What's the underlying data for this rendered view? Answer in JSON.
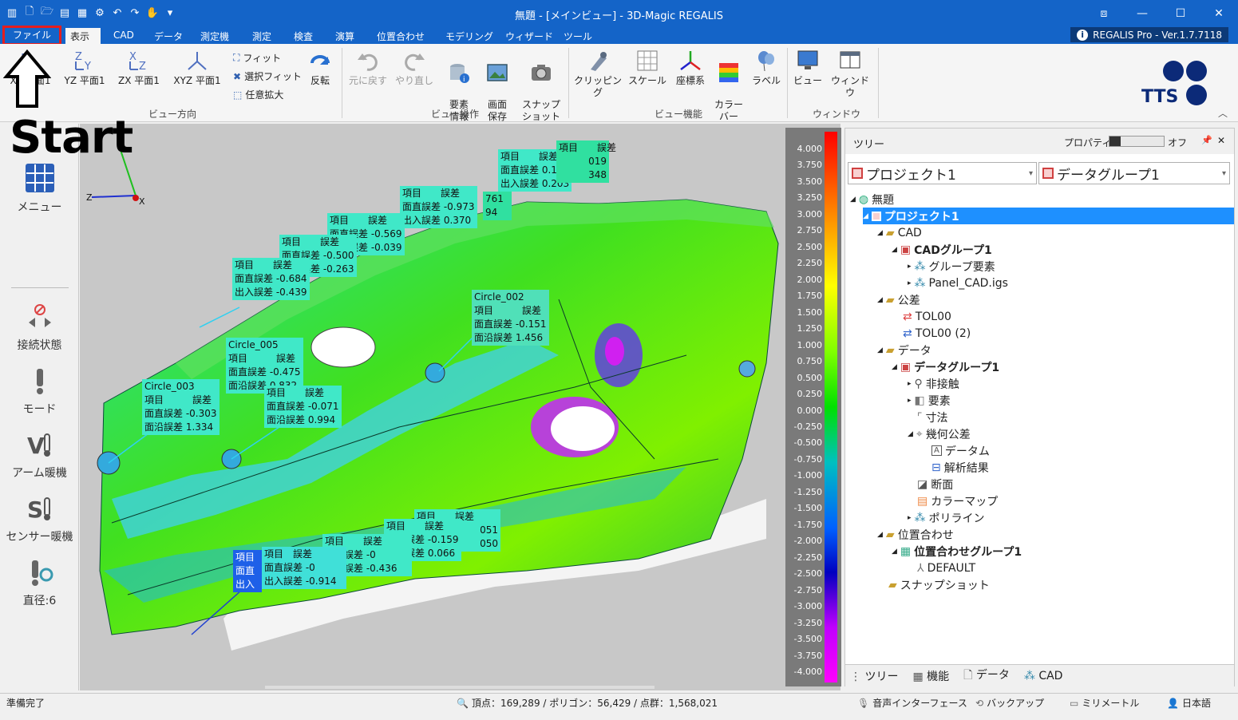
{
  "window": {
    "title": "無題 - [メインビュー] - 3D-Magic REGALIS"
  },
  "tabs": [
    {
      "label": "ファイル"
    },
    {
      "label": "表示"
    },
    {
      "label": "CAD"
    },
    {
      "label": "データ"
    },
    {
      "label": "測定機"
    },
    {
      "label": "測定"
    },
    {
      "label": "検査"
    },
    {
      "label": "演算"
    },
    {
      "label": "位置合わせ"
    },
    {
      "label": "モデリング"
    },
    {
      "label": "ウィザード"
    },
    {
      "label": "ツール"
    }
  ],
  "version": "REGALIS Pro - Ver.1.7.7118",
  "ribbon": {
    "view_direction": {
      "group_label": "ビュー方向",
      "xy": "XY 平面1",
      "yz": "YZ 平面1",
      "zx": "ZX 平面1",
      "xyz": "XYZ 平面1",
      "fit": "フィット",
      "select_fit": "選択フィット",
      "zoom_any": "任意拡大",
      "flip": "反転"
    },
    "view_ops": {
      "group_label": "ビュー操作",
      "undo": "元に戻す",
      "redo": "やり直し",
      "elem_info": "要素\n情報",
      "save_screen": "画面\n保存",
      "snapshot": "スナップ\nショット"
    },
    "view_func": {
      "group_label": "ビュー機能",
      "clipping": "クリッピング",
      "scale": "スケール",
      "coord": "座標系",
      "colorbar": "カラー\nバー",
      "label": "ラベル"
    },
    "window": {
      "group_label": "ウィンドウ",
      "view": "ビュー",
      "window": "ウィンドウ"
    },
    "logo_text": "TTS"
  },
  "overlay": {
    "start": "Start"
  },
  "left_panel": {
    "menu": "メニュー",
    "connection": "接続状態",
    "mode": "モード",
    "arm_warmup": "アーム暖機",
    "sensor_warmup": "センサー暖機",
    "diameter": "直径:6"
  },
  "colorbar": {
    "ticks": [
      "4.000",
      "3.750",
      "3.500",
      "3.250",
      "3.000",
      "2.750",
      "2.500",
      "2.250",
      "2.000",
      "1.750",
      "1.500",
      "1.250",
      "1.000",
      "0.750",
      "0.500",
      "0.250",
      "0.000",
      "-0.250",
      "-0.500",
      "-0.750",
      "-1.000",
      "-1.250",
      "-1.500",
      "-1.750",
      "-2.000",
      "-2.250",
      "-2.500",
      "-2.750",
      "-3.000",
      "-3.250",
      "-3.500",
      "-3.750",
      "-4.000"
    ]
  },
  "labels": [
    {
      "lines": [
        "項目　　誤差",
        "面直誤差 0.171",
        "出入誤差 0.203"
      ]
    },
    {
      "lines": [
        "項目　　誤差",
        "019",
        "348"
      ]
    },
    {
      "lines": [
        "項目　　誤差",
        "面直誤差 -0.973",
        "出入誤差 0.370"
      ]
    },
    {
      "lines": [
        "761",
        "94"
      ]
    },
    {
      "lines": [
        "項目　　誤差",
        "面直誤差 -0.569",
        "出入誤差 -0.039"
      ]
    },
    {
      "lines": [
        "項目　　誤差",
        "面直誤差 -0.500",
        "出入誤差 -0.263"
      ]
    },
    {
      "lines": [
        "項目　　誤差",
        "面直誤差 -0.684",
        "出入誤差 -0.439"
      ]
    },
    {
      "lines": [
        "Circle_002",
        "項目　　　誤差",
        "面直誤差 -0.151",
        "面沿誤差 1.456"
      ]
    },
    {
      "lines": [
        "Circle_005",
        "項目　　　誤差",
        "面直誤差 -0.475",
        "面沿誤差 0.832"
      ]
    },
    {
      "lines": [
        "項目　　誤差",
        "面直誤差 -0.071",
        "面沿誤差 0.994"
      ]
    },
    {
      "lines": [
        "Circle_003",
        "項目　　　誤差",
        "面直誤差 -0.303",
        "面沿誤差 1.334"
      ]
    },
    {
      "lines": [
        "項目　　誤差",
        "051",
        "050"
      ]
    },
    {
      "lines": [
        "項目　　誤差",
        "面直誤差 -0.159",
        "出入誤差 0.066"
      ]
    },
    {
      "lines": [
        "項目　　誤差",
        "面直誤差 -0",
        "出入誤差 -0.436"
      ]
    },
    {
      "lines": [
        "項目　誤差",
        "面直誤差 -0",
        "出入誤差 -0.914"
      ]
    },
    {
      "lines": [
        "項目",
        "面直",
        "出入"
      ]
    }
  ],
  "right_panel": {
    "title": "ツリー",
    "property_label": "プロパティ",
    "off_label": "オフ",
    "project_combo": "プロジェクト1",
    "datagroup_combo": "データグループ1",
    "tree": [
      {
        "label": "無題"
      },
      {
        "label": "プロジェクト1"
      },
      {
        "label": "CAD"
      },
      {
        "label": "CADグループ1"
      },
      {
        "label": "グループ要素"
      },
      {
        "label": "Panel_CAD.igs"
      },
      {
        "label": "公差"
      },
      {
        "label": "TOL00"
      },
      {
        "label": "TOL00 (2)"
      },
      {
        "label": "データ"
      },
      {
        "label": "データグループ1"
      },
      {
        "label": "非接触"
      },
      {
        "label": "要素"
      },
      {
        "label": "寸法"
      },
      {
        "label": "幾何公差"
      },
      {
        "label": "データム"
      },
      {
        "label": "解析結果"
      },
      {
        "label": "断面"
      },
      {
        "label": "カラーマップ"
      },
      {
        "label": "ポリライン"
      },
      {
        "label": "位置合わせ"
      },
      {
        "label": "位置合わせグループ1"
      },
      {
        "label": "DEFAULT"
      },
      {
        "label": "スナップショット"
      }
    ],
    "bottom_tabs": [
      "ツリー",
      "機能",
      "データ",
      "CAD"
    ]
  },
  "status": {
    "ready": "準備完了",
    "counts": "頂点：169,289 / ポリゴン：56,429 / 点群：1,568,021",
    "voice": "音声インターフェース",
    "backup": "バックアップ",
    "unit": "ミリメートル",
    "lang": "日本語"
  },
  "colors": {
    "accent": "#1464c8",
    "highlight": "#e51d1d",
    "label_bg": "#40e0c0"
  }
}
